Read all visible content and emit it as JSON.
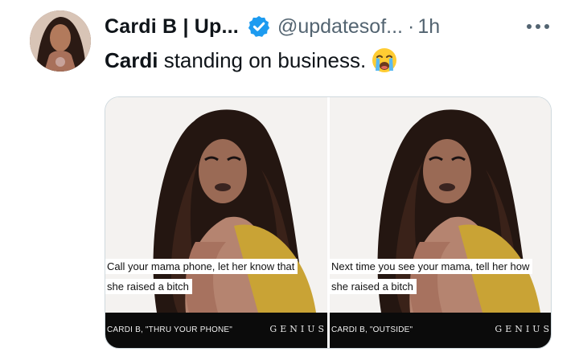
{
  "tweet": {
    "display_name": "Cardi B | Up...",
    "handle": "@updatesof...",
    "separator": "·",
    "time": "1h",
    "more_label": "More",
    "text_bold": "Cardi",
    "text_rest": " standing on business.",
    "emoji": "loudly-crying-face"
  },
  "media": {
    "panels": [
      {
        "caption_line1": "Call your mama phone, let her know that",
        "caption_line2": "she raised a bitch",
        "footer_label": "CARDI B, \"THRU YOUR PHONE\"",
        "footer_brand": "GENIUS"
      },
      {
        "caption_line1": "Next time you see your mama, tell her how",
        "caption_line2": "she raised a bitch",
        "footer_label": "CARDI B, \"OUTSIDE\"",
        "footer_brand": "GENIUS"
      }
    ]
  },
  "colors": {
    "text": "#0f1419",
    "muted": "#536471",
    "verified": "#1d9bf0",
    "border": "#cfd9de"
  }
}
